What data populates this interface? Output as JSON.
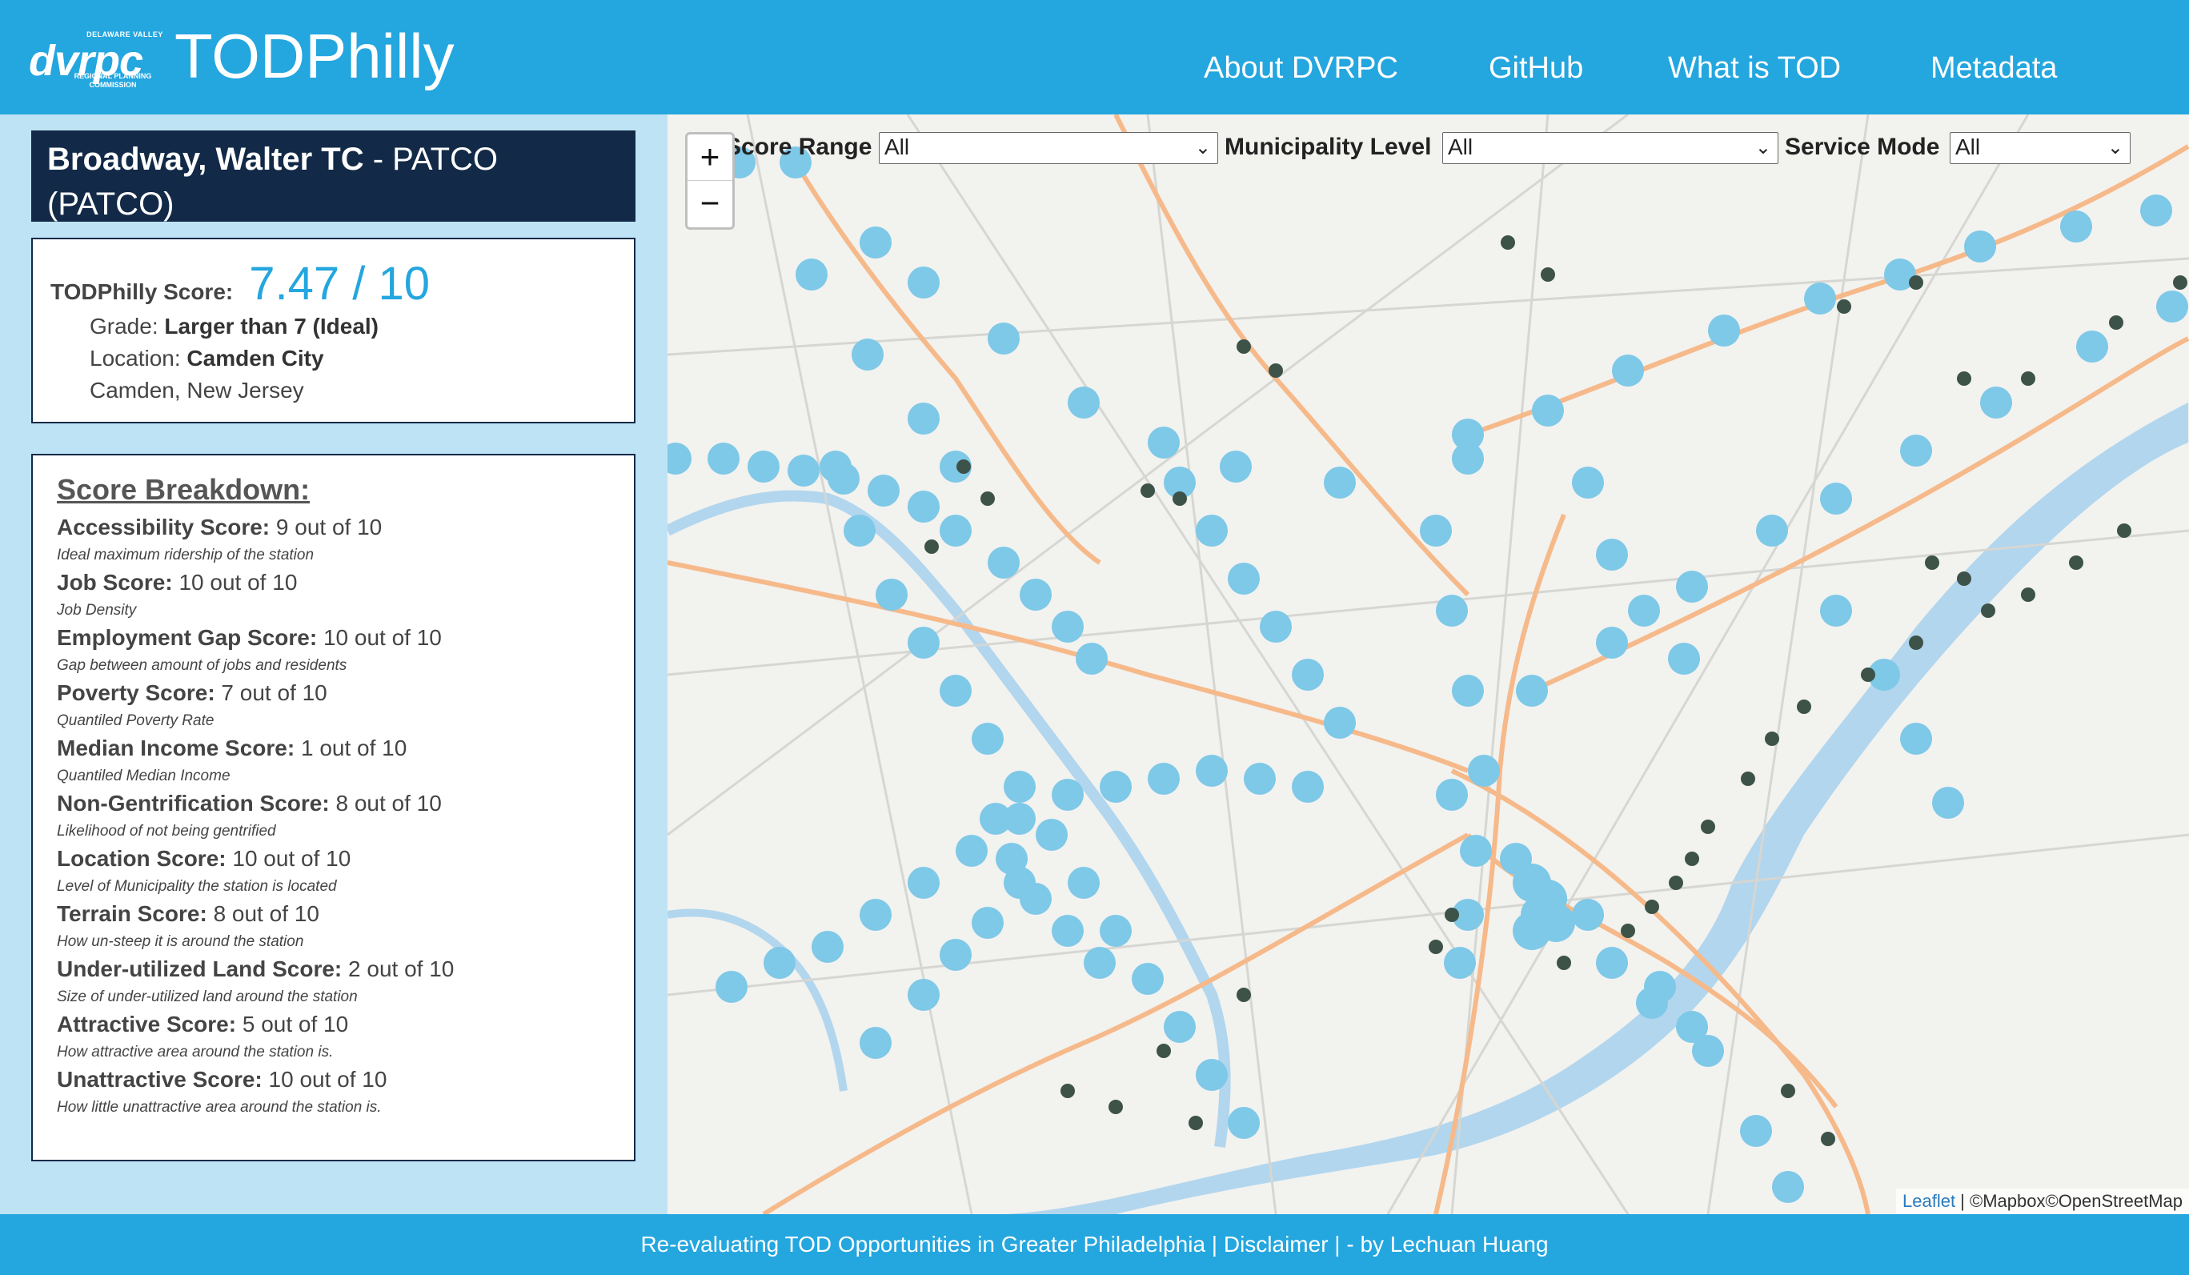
{
  "header": {
    "logo_tagline": "DELAWARE VALLEY",
    "logo_mark": "dvrpc",
    "logo_sub": "REGIONAL PLANNING COMMISSION",
    "title": "TODPhilly",
    "nav": [
      "About DVRPC",
      "GitHub",
      "What is TOD",
      "Metadata"
    ]
  },
  "station": {
    "name": "Broadway, Walter TC",
    "line": " - PATCO (PATCO)"
  },
  "score": {
    "label": "TODPhilly Score:",
    "value": "7.47 / 10",
    "grade_label": "Grade:",
    "grade": "Larger than 7 (Ideal)",
    "location_label": "Location:",
    "location": "Camden City",
    "region": "Camden, New Jersey"
  },
  "breakdown": {
    "title": "Score Breakdown:",
    "items": [
      {
        "label": "Accessibility Score:",
        "value": "9 out of 10",
        "note": "Ideal maximum ridership of the station"
      },
      {
        "label": "Job Score:",
        "value": "10 out of 10",
        "note": "Job Density"
      },
      {
        "label": "Employment Gap Score:",
        "value": "10 out of 10",
        "note": "Gap between amount of jobs and residents"
      },
      {
        "label": "Poverty Score:",
        "value": "7 out of 10",
        "note": "Quantiled Poverty Rate"
      },
      {
        "label": "Median Income Score:",
        "value": "1 out of 10",
        "note": "Quantiled Median Income"
      },
      {
        "label": "Non-Gentrification Score:",
        "value": "8 out of 10",
        "note": "Likelihood of not being gentrified"
      },
      {
        "label": "Location Score:",
        "value": "10 out of 10",
        "note": "Level of Municipality the station is located"
      },
      {
        "label": "Terrain Score:",
        "value": "8 out of 10",
        "note": "How un-steep it is around the station"
      },
      {
        "label": "Under-utilized Land Score:",
        "value": "2 out of 10",
        "note": "Size of under-utilized land around the station"
      },
      {
        "label": "Attractive Score:",
        "value": "5 out of 10",
        "note": "How attractive area around the station is."
      },
      {
        "label": "Unattractive Score:",
        "value": "10 out of 10",
        "note": "How little unattractive area around the station is."
      }
    ]
  },
  "filters": {
    "score_range_label": "Score Range",
    "score_range_value": "All",
    "municipality_label": "Municipality Level",
    "municipality_value": "All",
    "service_label": "Service Mode",
    "service_value": "All"
  },
  "map": {
    "zoom_in": "+",
    "zoom_out": "−",
    "attribution_leaflet": "Leaflet",
    "attribution_rest": " | ©Mapbox©OpenStreetMap",
    "colors": {
      "station": "#7ec8e8",
      "secondary_station": "#3d5248",
      "rail": "#f6b98a",
      "water": "#b2d6ee",
      "land": "#f2f2ef"
    }
  },
  "footer": {
    "text": "Re-evaluating TOD Opportunities in Greater Philadelphia  |    Disclaimer  |    - by Lechuan Huang"
  }
}
